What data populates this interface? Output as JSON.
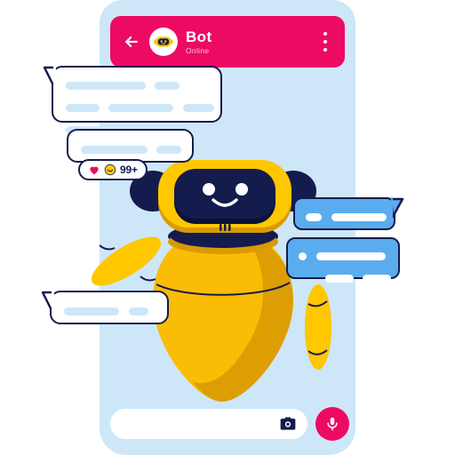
{
  "app": {
    "background_color": "#FFFFFF",
    "phone_background": "#CDE7F9"
  },
  "header": {
    "title": "Bot",
    "status": "Online",
    "accent_color": "#ED0A62",
    "back_icon": "back-arrow-icon",
    "avatar_icon": "bot-avatar-icon",
    "menu_icon": "more-vertical-icon"
  },
  "messages": [
    {
      "id": "bubble1",
      "direction": "incoming",
      "color": "#FFFFFF",
      "outline": "#141B4D",
      "lines": [
        [
          78,
          26
        ],
        [
          40,
          70,
          38
        ],
        [
          60,
          0
        ]
      ]
    },
    {
      "id": "bubble2",
      "direction": "incoming",
      "color": "#FFFFFF",
      "outline": "#141B4D",
      "lines": [
        [
          70,
          26
        ]
      ]
    },
    {
      "id": "bubble3",
      "direction": "incoming",
      "color": "#FFFFFF",
      "outline": "#141B4D",
      "lines": [
        [
          58,
          20
        ]
      ]
    },
    {
      "id": "bubble4",
      "direction": "outgoing",
      "color": "#5BACEE",
      "outline": "#141B4D",
      "lines": [
        [
          16,
          62
        ]
      ]
    },
    {
      "id": "bubble5",
      "direction": "outgoing",
      "color": "#5BACEE",
      "outline": "#141B4D",
      "lines": [
        [
          0,
          78
        ],
        [
          30,
          30
        ]
      ]
    }
  ],
  "reactions": {
    "count_label": "99+",
    "emojis": [
      "heart-emoji",
      "smiley-emoji"
    ],
    "heart_color": "#ED0A62",
    "smiley_color": "#F9C80E"
  },
  "robot": {
    "head_color": "#FFC700",
    "face_color": "#141B4D",
    "body_color": "#FBBC05",
    "body_shadow": "#D99A04",
    "eye_color": "#FFFFFF",
    "expression": "smiling"
  },
  "input_bar": {
    "placeholder": "",
    "value": "",
    "camera_icon": "camera-icon",
    "mic_icon": "microphone-icon",
    "mic_color": "#ED0A62",
    "field_color": "#FFFFFF"
  }
}
